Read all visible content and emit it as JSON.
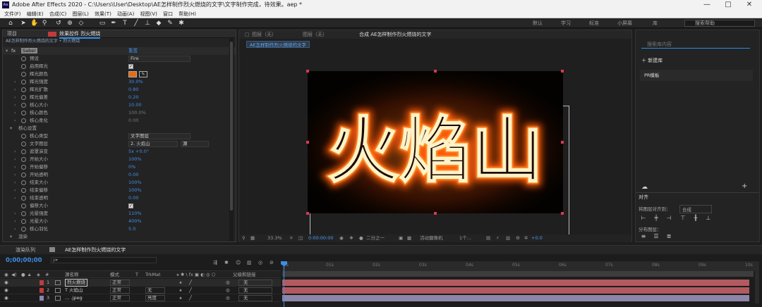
{
  "window": {
    "title": "Adobe After Effects 2020 - C:\\Users\\User\\Desktop\\AE怎样制作烈火燃烧的文字\\文字制作完成，待效果。aep *",
    "logo": "Ae",
    "minimize": "—",
    "restore": "□",
    "close": "✕"
  },
  "menu": [
    "文件(F)",
    "编辑(E)",
    "合成(C)",
    "图层(L)",
    "效果(T)",
    "动画(A)",
    "视图(V)",
    "窗口",
    "帮助(H)"
  ],
  "toolbar": {
    "workspaces": [
      "默认",
      "学习",
      "标准",
      "小屏幕",
      "库"
    ],
    "search_placeholder": "搜索帮助"
  },
  "left_panel": {
    "tabs": [
      "项目",
      "效果控件 烈火燃烧"
    ],
    "breadcrumb": "AE怎样制作烈火燃烧的文字 • 烈火燃烧",
    "effect_header": {
      "name": "Saber",
      "reset": "重置"
    },
    "rows": [
      {
        "label": "预设",
        "type": "dropdown",
        "value": "Fire"
      },
      {
        "label": "启用辉光",
        "type": "check"
      },
      {
        "label": "辉光颜色",
        "type": "color",
        "value": "#e86a12"
      },
      {
        "label": "辉光强度",
        "type": "value",
        "value": "30.0%"
      },
      {
        "label": "辉光扩散",
        "type": "value",
        "value": "0.80"
      },
      {
        "label": "辉光偏差",
        "type": "value",
        "value": "0.20"
      },
      {
        "label": "核心大小",
        "type": "value",
        "value": "10.00"
      },
      {
        "label": "核心颜色",
        "type": "value-gray",
        "value": "100.0%"
      },
      {
        "label": "核心柔化",
        "type": "value-gray",
        "value": "0.00"
      },
      {
        "label": "核心设置",
        "type": "section"
      },
      {
        "label": "核心类型",
        "type": "dropdown",
        "value": "文字图层"
      },
      {
        "label": "文字图层",
        "type": "dropdown2",
        "value": "2. 火焰山",
        "value2": "源"
      },
      {
        "label": "遮罩演变",
        "type": "value",
        "value": "5x +0.0°"
      },
      {
        "label": "开始大小",
        "type": "value",
        "value": "100%"
      },
      {
        "label": "开始偏移",
        "type": "value",
        "value": "0%"
      },
      {
        "label": "开始透明",
        "type": "value",
        "value": "0.00"
      },
      {
        "label": "结束大小",
        "type": "value",
        "value": "100%"
      },
      {
        "label": "结束偏移",
        "type": "value",
        "value": "100%"
      },
      {
        "label": "结束透明",
        "type": "value",
        "value": "0.00"
      },
      {
        "label": "偏移大小",
        "type": "check"
      },
      {
        "label": "光晕强度",
        "type": "value",
        "value": "110%"
      },
      {
        "label": "光晕大小",
        "type": "value",
        "value": "400%"
      },
      {
        "label": "核心羽化",
        "type": "value",
        "value": "5.0"
      },
      {
        "label": "渲染",
        "type": "section"
      }
    ]
  },
  "viewer": {
    "tabs": [
      "图层（无）",
      "图层（无）",
      "合成 AE怎样制作烈火燃烧的文字",
      "对齐"
    ],
    "comp_chip": "AE怎样制作烈火燃烧的文字",
    "fire_text": "火焰山",
    "bar": {
      "zoom": "33.3%",
      "time": "0:00:00:00",
      "res": "二分之一",
      "camera": "活动摄像机",
      "views": "1个…",
      "exposure": "+0.0"
    }
  },
  "right_panel": {
    "search_placeholder": "搜索库内容",
    "new_library": "＋ 新建库",
    "library_item": "PR模板",
    "align": {
      "title": "对齐",
      "align_to_label": "将图层对齐到：",
      "align_to_value": "合成",
      "distribute_label": "分布图层："
    }
  },
  "timeline": {
    "tabs": [
      "渲染队列",
      "AE怎样制作烈火燃烧的文字"
    ],
    "timecode": "0;00;00;00",
    "search_placeholder": "ρ▾",
    "columns": {
      "name": "源名称",
      "mode": "模式",
      "trkmat": "TrkMat",
      "parent": "父级和链接"
    },
    "ruler": [
      "0s",
      "01s",
      "02s",
      "03s",
      "04s",
      "05s",
      "06s",
      "07s",
      "08s",
      "09s",
      "10s"
    ],
    "layers": [
      {
        "num": "1",
        "name": "烈火燃烧",
        "mode": "正常",
        "trkmat": "",
        "parent": "无",
        "color": "#c23b3b"
      },
      {
        "num": "2",
        "name": "T  火焰山",
        "mode": "正常",
        "trkmat": "无",
        "parent": "无",
        "color": "#c23b3b"
      },
      {
        "num": "3",
        "name": "… .jpeg",
        "mode": "正常",
        "trkmat": "亮度",
        "parent": "无",
        "color": "#8b84b4"
      }
    ]
  },
  "colors": {
    "accent": "#2d8ceb",
    "fire": "#e86a12"
  }
}
